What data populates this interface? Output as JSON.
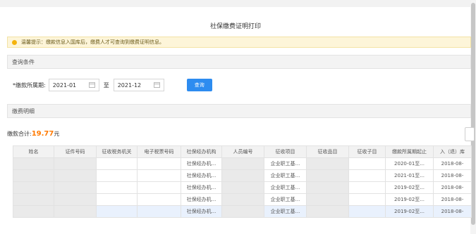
{
  "page": {
    "title": "社保缴费证明打印"
  },
  "notice": {
    "text": "温馨提示：缴款信息入国库后，缴费人才可查询到缴费证明信息。"
  },
  "query": {
    "section_title": "查询条件",
    "period_label": "*缴款所属期:",
    "start_value": "2021-01",
    "to_label": "至",
    "end_value": "2021-12",
    "button_label": "查询"
  },
  "details": {
    "section_title": "缴费明细",
    "total_label": "缴款合计:",
    "total_amount": "19.77",
    "total_unit": "元"
  },
  "table": {
    "columns": [
      "姓名",
      "证件号码",
      "征收税务机关",
      "电子税票号码",
      "社保经办机构",
      "人员编号",
      "征收项目",
      "征收品目",
      "征收子目",
      "缴款所属期起止",
      "入（退）库"
    ],
    "rows": [
      [
        "",
        "",
        "",
        "",
        "社保经办机...",
        "",
        "企业职工基...",
        "",
        "",
        "2020-01至...",
        "2018-08-"
      ],
      [
        "",
        "",
        "",
        "",
        "社保经办机...",
        "",
        "企业职工基...",
        "",
        "",
        "2021-01至...",
        "2018-08-"
      ],
      [
        "",
        "",
        "",
        "",
        "社保经办机...",
        "",
        "企业职工基...",
        "",
        "",
        "2019-02至...",
        "2018-08-"
      ],
      [
        "",
        "",
        "",
        "",
        "社保经办机...",
        "",
        "企业职工基...",
        "",
        "",
        "2019-02至...",
        "2018-08-"
      ],
      [
        "",
        "",
        "",
        "",
        "社保经办机...",
        "",
        "企业职工基...",
        "",
        "",
        "2019-02至...",
        "2018-08-"
      ]
    ]
  }
}
